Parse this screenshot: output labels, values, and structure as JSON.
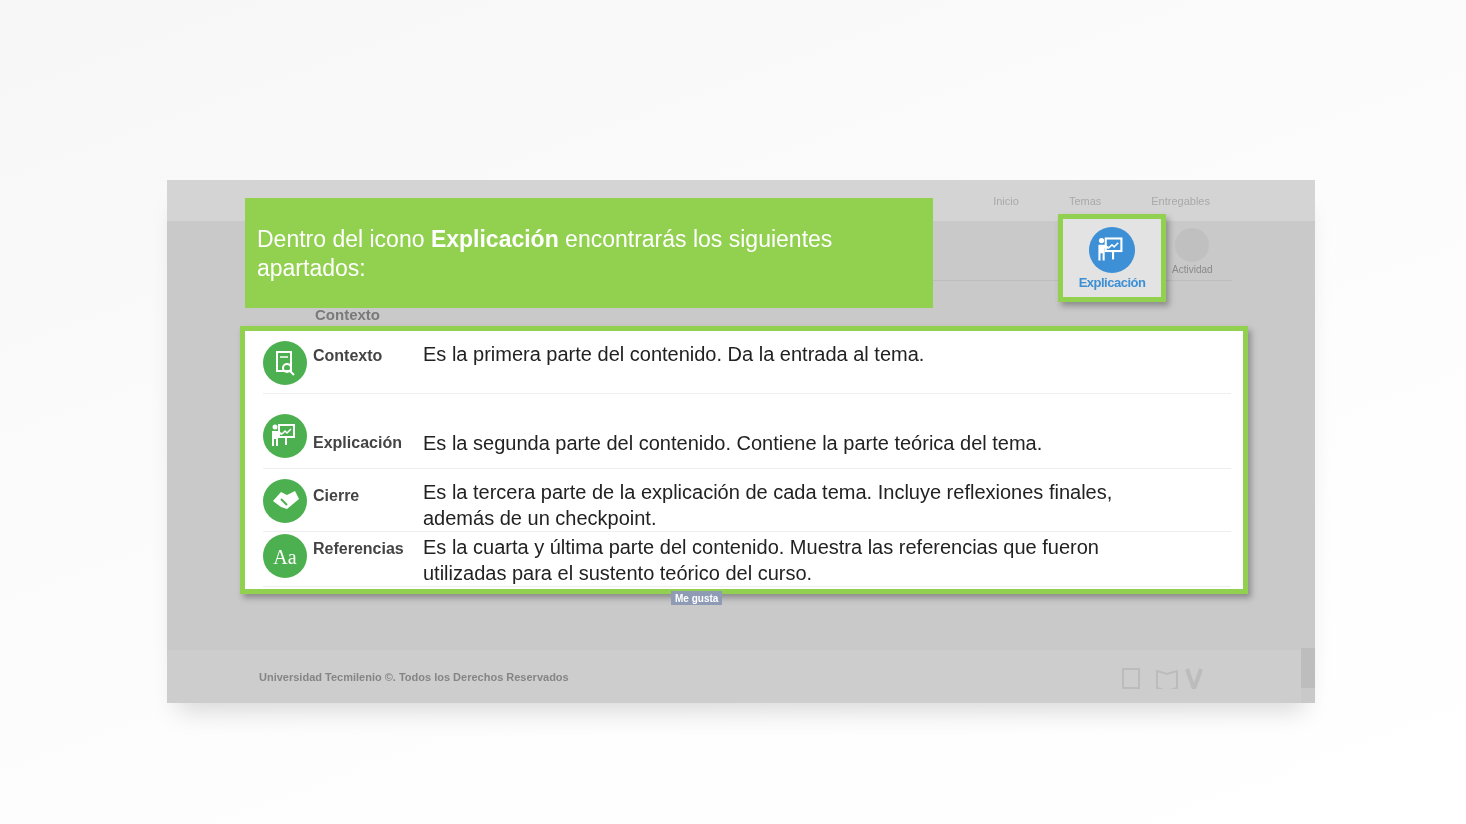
{
  "nav": [
    "Inicio",
    "Temas",
    "Entregables"
  ],
  "callout": {
    "text": "Dentro del icono **Explicación** encontrarás los siguientes apartados:"
  },
  "highlighted_tile": {
    "label": "Explicación"
  },
  "background_tile": {
    "label": "Actividad"
  },
  "background_section": {
    "label": "Contexto"
  },
  "sections": [
    {
      "kind": "context",
      "title": "Contexto",
      "description": "Es la primera parte del contenido. Da la entrada al tema."
    },
    {
      "kind": "explanation",
      "title": "Explicación",
      "description": "Es la segunda parte del contenido. Contiene la parte teórica del tema."
    },
    {
      "kind": "closing",
      "title": "Cierre",
      "description": "Es la tercera parte de la explicación de cada tema. Incluye reflexiones finales, además de un checkpoint."
    },
    {
      "kind": "references",
      "title": "Referencias",
      "icon_text": "Aa",
      "description": "Es la cuarta y última parte del contenido. Muestra las referencias que fueron utilizadas para el sustento teórico del curso."
    }
  ],
  "like_button": "Me gusta",
  "footer": "Universidad Tecmilenio ©. Todos los Derechos Reservados"
}
